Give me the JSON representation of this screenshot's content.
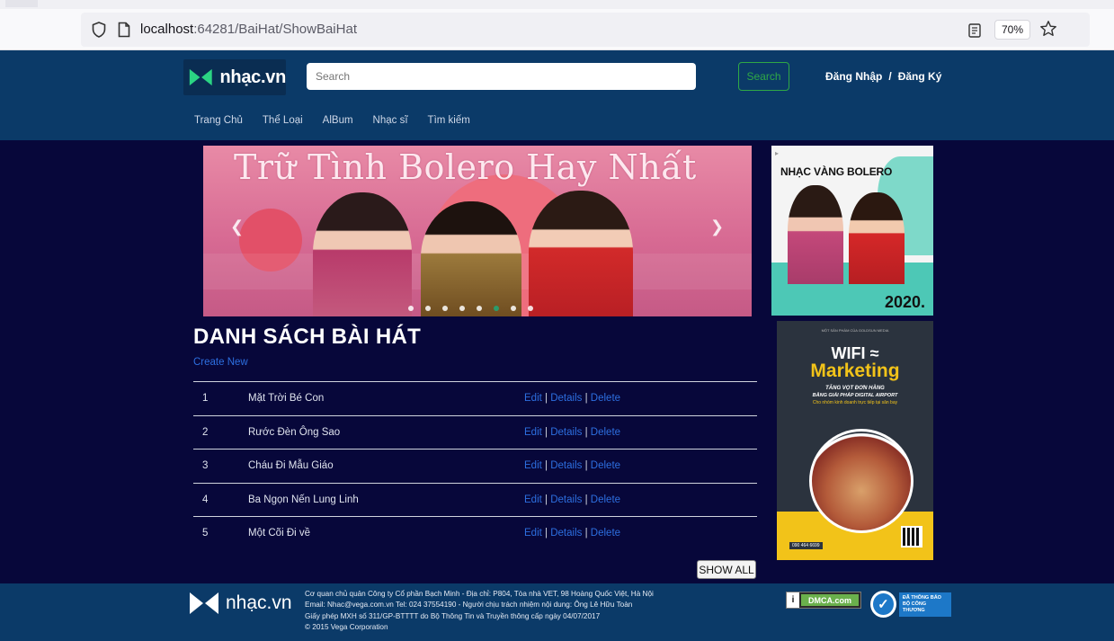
{
  "browser": {
    "url_host": "localhost",
    "url_rest": ":64281/BaiHat/ShowBaiHat",
    "zoom": "70%"
  },
  "header": {
    "logo_text": "nhạc.vn",
    "search_placeholder": "Search",
    "search_button": "Search",
    "login": "Đăng Nhập",
    "separator": "/",
    "register": "Đăng Ký",
    "nav": [
      "Trang Chủ",
      "Thể Loại",
      "AlBum",
      "Nhạc sĩ",
      "Tìm kiếm"
    ]
  },
  "banner": {
    "title": "Trữ Tình Bolero Hay Nhất",
    "slide_count": 8,
    "active_slide": 6
  },
  "ads": {
    "ad1_title": "NHẠC VÀNG BOLERO",
    "ad1_year": "2020.",
    "ad2_top": "MỘT SẢN PHẨM CỦA GOLDSUN MEDIA",
    "ad2_wifi": "WIFI",
    "ad2_marketing": "Marketing",
    "ad2_sub1": "TĂNG VỌT ĐƠN HÀNG",
    "ad2_sub2": "BẰNG GIẢI PHÁP DIGITAL AIRPORT",
    "ad2_sub3": "Cho nhóm kinh doanh trực tiếp tại sân bay",
    "ad2_phone": "090 464 6699"
  },
  "songs": {
    "title": "DANH SÁCH BÀI HÁT",
    "create_new": "Create New",
    "edit": "Edit",
    "details": "Details",
    "delete": "Delete",
    "pipe": "|",
    "rows": [
      {
        "num": "1",
        "name": "Mặt Trời Bé Con"
      },
      {
        "num": "2",
        "name": "Rước Đèn Ông Sao"
      },
      {
        "num": "3",
        "name": "Cháu Đi Mẫu Giáo"
      },
      {
        "num": "4",
        "name": "Ba Ngọn Nến Lung Linh"
      },
      {
        "num": "5",
        "name": "Một Cõi Đi về"
      }
    ],
    "show_all": "SHOW ALL"
  },
  "footer": {
    "logo_text": "nhạc.vn",
    "line1": "Cơ quan chủ quản Công ty Cổ phần Bạch Minh - Địa chỉ: P804, Tòa nhà VET, 98 Hoàng Quốc Việt, Hà Nội",
    "line2": "Email: Nhac@vega.com.vn Tel: 024 37554190 - Người chịu trách nhiệm nội dung: Ông Lê Hữu Toàn",
    "line3": "Giấy phép MXH số 311/GP-BTTTT do Bộ Thông Tin và Truyền thông cấp ngày 04/07/2017",
    "line4": "© 2015 Vega Corporation",
    "dmca": "DMCA.com",
    "bct_line1": "ĐÃ THÔNG BÁO",
    "bct_line2": "BỘ CÔNG THƯƠNG"
  },
  "colors": {
    "header_bg": "#0b3a68",
    "page_bg": "#07073a",
    "link": "#2d6fe0",
    "search_button_border": "#2fa846"
  }
}
